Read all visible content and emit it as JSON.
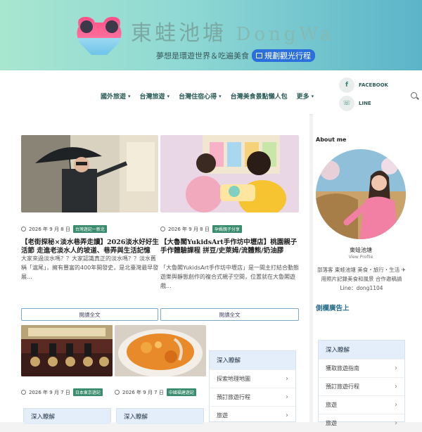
{
  "header": {
    "title_cn": "東蛙池塘",
    "title_en": "DongWa",
    "tagline": "夢想是環遊世界＆吃遍美食",
    "plan_button": "規劃觀光行程"
  },
  "nav": {
    "items": [
      {
        "label": "國外旅遊",
        "caret": "▾"
      },
      {
        "label": "台灣旅遊",
        "caret": "▾"
      },
      {
        "label": "台灣住宿心得",
        "caret": "▾"
      },
      {
        "label": "台灣美食景點懶人包",
        "caret": ""
      },
      {
        "label": "更多",
        "caret": "▾"
      }
    ],
    "social": [
      {
        "label": "FACEBOOK",
        "icon": "f"
      },
      {
        "label": "LINE",
        "icon": "☏"
      }
    ]
  },
  "posts": [
    {
      "date": "2026 年 9 月 8 日",
      "tag": "台灣遊記一新北",
      "title": "【老街探秘×淡水巷弄走讀】2026淡水好好生活節 走進老淡水人的坡道、巷弄與生活記憶",
      "excerpt": "大家來過淡水嗎？？大家認識真正的淡水嗎？？淡水舊稱「滬尾」，擁有豐富的400年開發史，是北臺灣最早發展...",
      "button": "閱讀全文"
    },
    {
      "date": "2026 年 9 月 8 日",
      "tag": "孕媽親子分享",
      "title": "【大魯閣YukidsArt手作坊中壢店】桃園親子手作體驗課程 拼豆/史萊姆/流體熊/奶油膠",
      "excerpt": "「大魯閣YukidsArt手作坊中壢店」是一間主打結合動態遊樂與靜態創作的複合式親子空間，位置就在大魯閣遊戲...",
      "button": "閱讀全文"
    },
    {
      "date": "2026 年 9 月 7 日",
      "tag": "日本東京遊記"
    },
    {
      "date": "2026 年 9 月 7 日",
      "tag": "中國福建遊記"
    }
  ],
  "deep_box": {
    "title": "深入瞭解",
    "rows": [
      "探索地理地圖",
      "預訂旅遊行程",
      "旅遊"
    ]
  },
  "bottom_boxes": [
    "深入瞭解",
    "深入瞭解"
  ],
  "sidebar": {
    "about_title": "About me",
    "name": "東蛙池塘",
    "view_profile": "View Profile",
    "desc": "部落客 東蛙池塘 美食・旅行・生活 ✈用照片記錄美食和風景 合作邀稿請Line：dong1104",
    "ad_title": "側欄廣告上",
    "deep_box": {
      "title": "深入瞭解",
      "rows": [
        "獲取旅遊指南",
        "預訂旅遊行程",
        "旅遊",
        "旅遊"
      ]
    }
  },
  "colors": {
    "accent": "#2a6fdb",
    "nav_text": "#2a5b56",
    "tag_green": "#3a8c6e",
    "header_start": "#a8e6cf",
    "header_end": "#5bb4c8"
  }
}
